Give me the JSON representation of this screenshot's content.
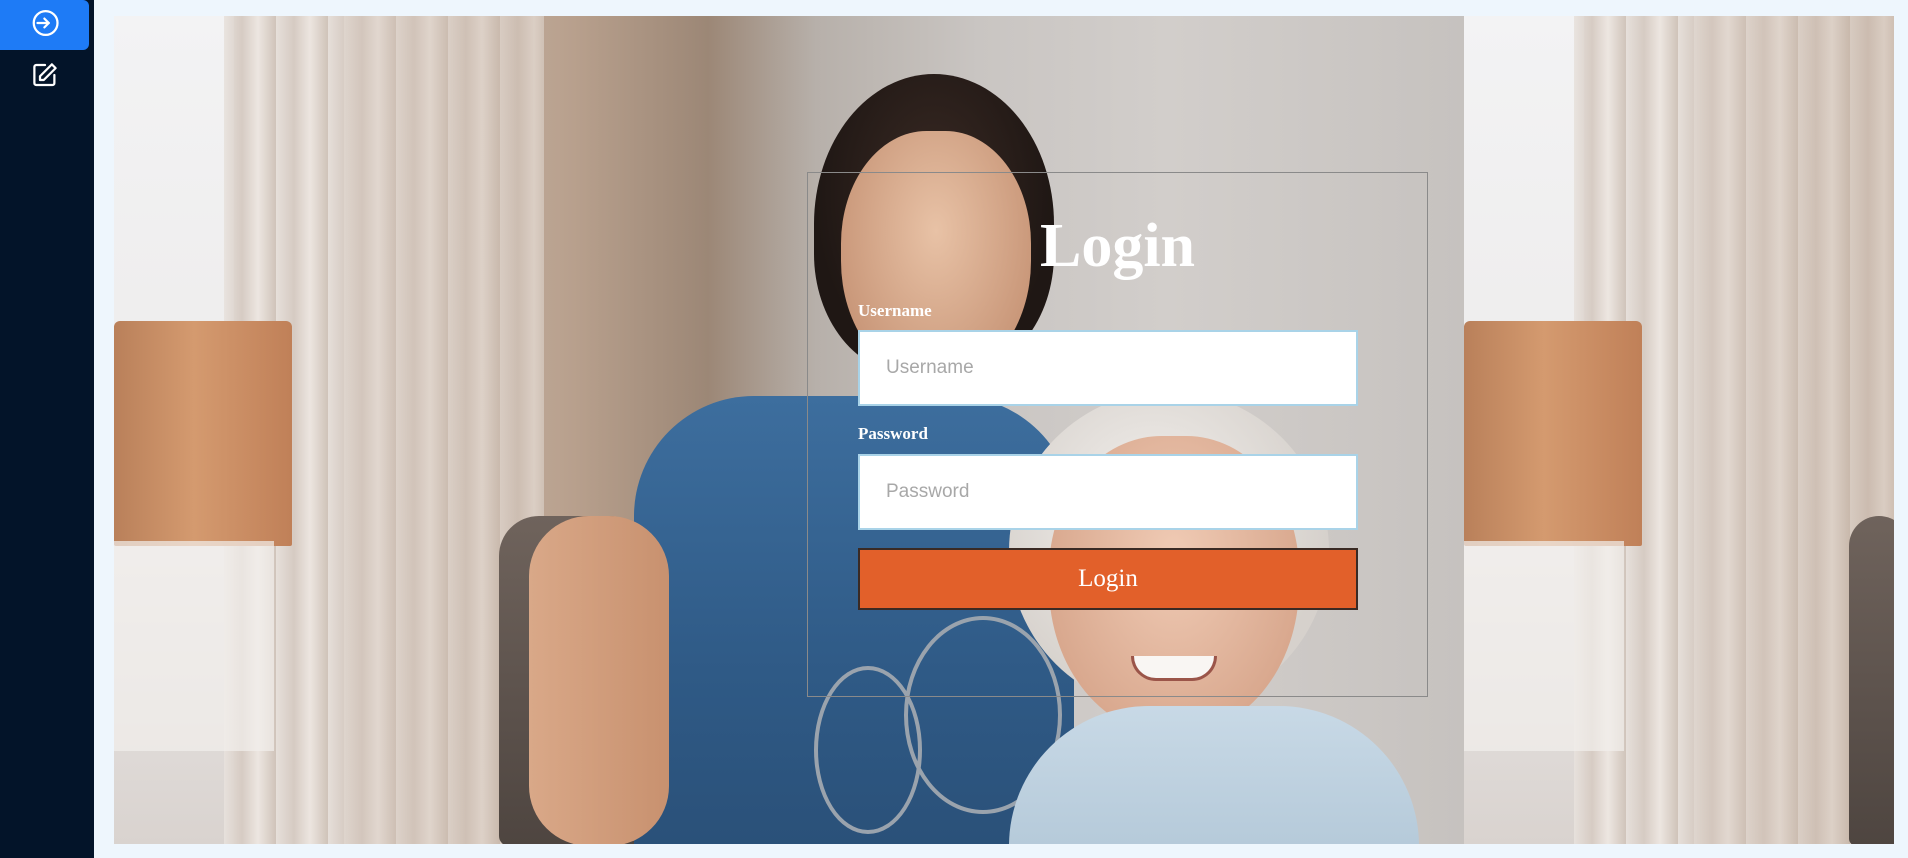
{
  "sidebar": {
    "items": [
      {
        "icon": "login-icon",
        "active": true
      },
      {
        "icon": "edit-icon",
        "active": false
      }
    ]
  },
  "login": {
    "title": "Login",
    "username_label": "Username",
    "username_placeholder": "Username",
    "username_value": "",
    "password_label": "Password",
    "password_placeholder": "Password",
    "password_value": "",
    "submit_label": "Login"
  },
  "colors": {
    "sidebar_bg": "#031429",
    "active_accent": "#1e7bf6",
    "button": "#e2602a"
  }
}
